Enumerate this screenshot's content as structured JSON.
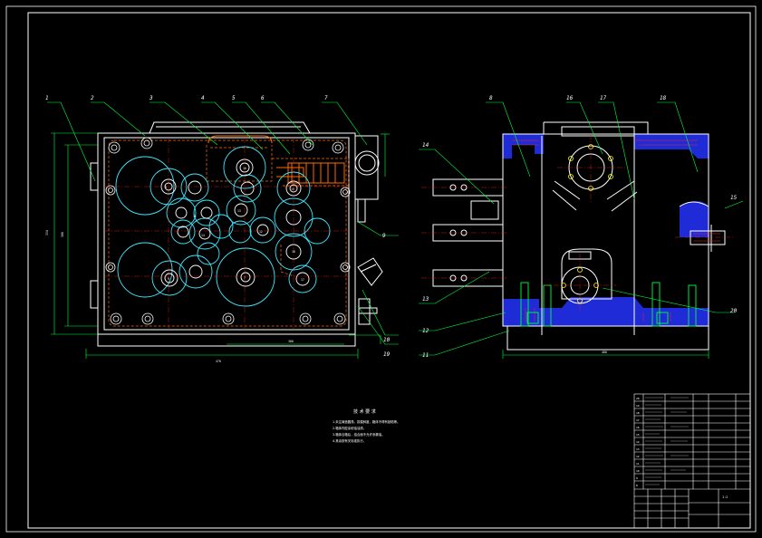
{
  "drawing": {
    "front_view_part_numbers": [
      "1",
      "2",
      "3",
      "4",
      "5",
      "6",
      "7"
    ],
    "side_view_part_numbers": [
      "8",
      "10",
      "11",
      "12",
      "13",
      "14",
      "15",
      "16",
      "17",
      "18",
      "19",
      "20"
    ],
    "notes": {
      "title": "技 术 要 求",
      "lines": [
        "1.未注铸造圆角，拔模斜度，箱体不得有缺陷等。",
        "2.箱体内腔涂耐油油漆。",
        "3.箱体合箱后，结合面不允许渗漏油。",
        "4.其余按有关标准执行。"
      ]
    },
    "title_block": {
      "scale": "1:2",
      "sheet": "1"
    }
  },
  "colors": {
    "background": "#000000",
    "border": "#ffffff",
    "outline": "#ffffff",
    "hidden": "#ff6a00",
    "gear": "#3fe8ff",
    "dimension": "#00ff3c",
    "leader": "#00ff3c",
    "center": "#ff2020",
    "section_fill": "#1f2bd6",
    "hatch": "#ff2020",
    "yellow": "#ffff00",
    "magenta": "#ff40ff"
  }
}
